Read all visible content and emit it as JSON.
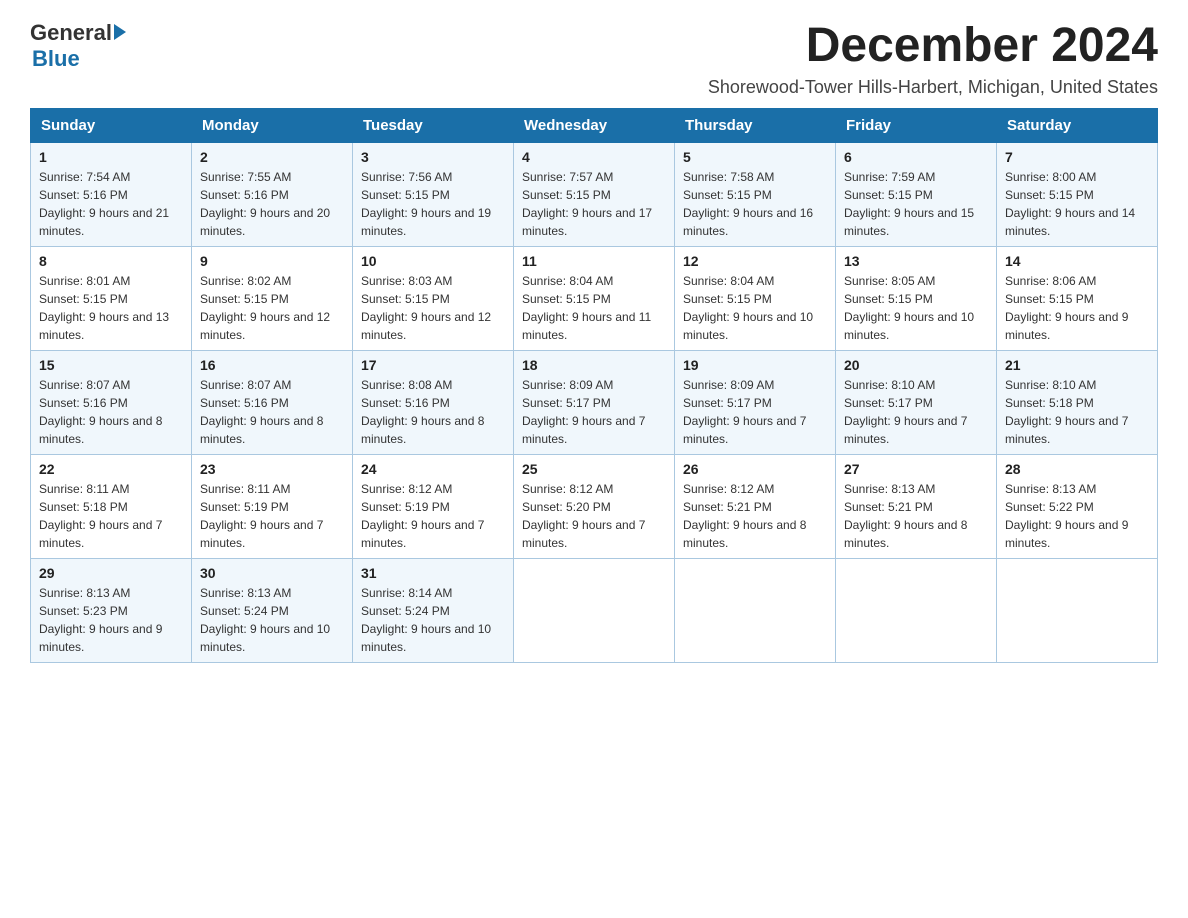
{
  "header": {
    "logo": {
      "general_text": "General",
      "blue_text": "Blue"
    },
    "title": "December 2024",
    "subtitle": "Shorewood-Tower Hills-Harbert, Michigan, United States"
  },
  "days_of_week": [
    "Sunday",
    "Monday",
    "Tuesday",
    "Wednesday",
    "Thursday",
    "Friday",
    "Saturday"
  ],
  "weeks": [
    [
      {
        "date": "1",
        "sunrise": "Sunrise: 7:54 AM",
        "sunset": "Sunset: 5:16 PM",
        "daylight": "Daylight: 9 hours and 21 minutes."
      },
      {
        "date": "2",
        "sunrise": "Sunrise: 7:55 AM",
        "sunset": "Sunset: 5:16 PM",
        "daylight": "Daylight: 9 hours and 20 minutes."
      },
      {
        "date": "3",
        "sunrise": "Sunrise: 7:56 AM",
        "sunset": "Sunset: 5:15 PM",
        "daylight": "Daylight: 9 hours and 19 minutes."
      },
      {
        "date": "4",
        "sunrise": "Sunrise: 7:57 AM",
        "sunset": "Sunset: 5:15 PM",
        "daylight": "Daylight: 9 hours and 17 minutes."
      },
      {
        "date": "5",
        "sunrise": "Sunrise: 7:58 AM",
        "sunset": "Sunset: 5:15 PM",
        "daylight": "Daylight: 9 hours and 16 minutes."
      },
      {
        "date": "6",
        "sunrise": "Sunrise: 7:59 AM",
        "sunset": "Sunset: 5:15 PM",
        "daylight": "Daylight: 9 hours and 15 minutes."
      },
      {
        "date": "7",
        "sunrise": "Sunrise: 8:00 AM",
        "sunset": "Sunset: 5:15 PM",
        "daylight": "Daylight: 9 hours and 14 minutes."
      }
    ],
    [
      {
        "date": "8",
        "sunrise": "Sunrise: 8:01 AM",
        "sunset": "Sunset: 5:15 PM",
        "daylight": "Daylight: 9 hours and 13 minutes."
      },
      {
        "date": "9",
        "sunrise": "Sunrise: 8:02 AM",
        "sunset": "Sunset: 5:15 PM",
        "daylight": "Daylight: 9 hours and 12 minutes."
      },
      {
        "date": "10",
        "sunrise": "Sunrise: 8:03 AM",
        "sunset": "Sunset: 5:15 PM",
        "daylight": "Daylight: 9 hours and 12 minutes."
      },
      {
        "date": "11",
        "sunrise": "Sunrise: 8:04 AM",
        "sunset": "Sunset: 5:15 PM",
        "daylight": "Daylight: 9 hours and 11 minutes."
      },
      {
        "date": "12",
        "sunrise": "Sunrise: 8:04 AM",
        "sunset": "Sunset: 5:15 PM",
        "daylight": "Daylight: 9 hours and 10 minutes."
      },
      {
        "date": "13",
        "sunrise": "Sunrise: 8:05 AM",
        "sunset": "Sunset: 5:15 PM",
        "daylight": "Daylight: 9 hours and 10 minutes."
      },
      {
        "date": "14",
        "sunrise": "Sunrise: 8:06 AM",
        "sunset": "Sunset: 5:15 PM",
        "daylight": "Daylight: 9 hours and 9 minutes."
      }
    ],
    [
      {
        "date": "15",
        "sunrise": "Sunrise: 8:07 AM",
        "sunset": "Sunset: 5:16 PM",
        "daylight": "Daylight: 9 hours and 8 minutes."
      },
      {
        "date": "16",
        "sunrise": "Sunrise: 8:07 AM",
        "sunset": "Sunset: 5:16 PM",
        "daylight": "Daylight: 9 hours and 8 minutes."
      },
      {
        "date": "17",
        "sunrise": "Sunrise: 8:08 AM",
        "sunset": "Sunset: 5:16 PM",
        "daylight": "Daylight: 9 hours and 8 minutes."
      },
      {
        "date": "18",
        "sunrise": "Sunrise: 8:09 AM",
        "sunset": "Sunset: 5:17 PM",
        "daylight": "Daylight: 9 hours and 7 minutes."
      },
      {
        "date": "19",
        "sunrise": "Sunrise: 8:09 AM",
        "sunset": "Sunset: 5:17 PM",
        "daylight": "Daylight: 9 hours and 7 minutes."
      },
      {
        "date": "20",
        "sunrise": "Sunrise: 8:10 AM",
        "sunset": "Sunset: 5:17 PM",
        "daylight": "Daylight: 9 hours and 7 minutes."
      },
      {
        "date": "21",
        "sunrise": "Sunrise: 8:10 AM",
        "sunset": "Sunset: 5:18 PM",
        "daylight": "Daylight: 9 hours and 7 minutes."
      }
    ],
    [
      {
        "date": "22",
        "sunrise": "Sunrise: 8:11 AM",
        "sunset": "Sunset: 5:18 PM",
        "daylight": "Daylight: 9 hours and 7 minutes."
      },
      {
        "date": "23",
        "sunrise": "Sunrise: 8:11 AM",
        "sunset": "Sunset: 5:19 PM",
        "daylight": "Daylight: 9 hours and 7 minutes."
      },
      {
        "date": "24",
        "sunrise": "Sunrise: 8:12 AM",
        "sunset": "Sunset: 5:19 PM",
        "daylight": "Daylight: 9 hours and 7 minutes."
      },
      {
        "date": "25",
        "sunrise": "Sunrise: 8:12 AM",
        "sunset": "Sunset: 5:20 PM",
        "daylight": "Daylight: 9 hours and 7 minutes."
      },
      {
        "date": "26",
        "sunrise": "Sunrise: 8:12 AM",
        "sunset": "Sunset: 5:21 PM",
        "daylight": "Daylight: 9 hours and 8 minutes."
      },
      {
        "date": "27",
        "sunrise": "Sunrise: 8:13 AM",
        "sunset": "Sunset: 5:21 PM",
        "daylight": "Daylight: 9 hours and 8 minutes."
      },
      {
        "date": "28",
        "sunrise": "Sunrise: 8:13 AM",
        "sunset": "Sunset: 5:22 PM",
        "daylight": "Daylight: 9 hours and 9 minutes."
      }
    ],
    [
      {
        "date": "29",
        "sunrise": "Sunrise: 8:13 AM",
        "sunset": "Sunset: 5:23 PM",
        "daylight": "Daylight: 9 hours and 9 minutes."
      },
      {
        "date": "30",
        "sunrise": "Sunrise: 8:13 AM",
        "sunset": "Sunset: 5:24 PM",
        "daylight": "Daylight: 9 hours and 10 minutes."
      },
      {
        "date": "31",
        "sunrise": "Sunrise: 8:14 AM",
        "sunset": "Sunset: 5:24 PM",
        "daylight": "Daylight: 9 hours and 10 minutes."
      },
      null,
      null,
      null,
      null
    ]
  ]
}
